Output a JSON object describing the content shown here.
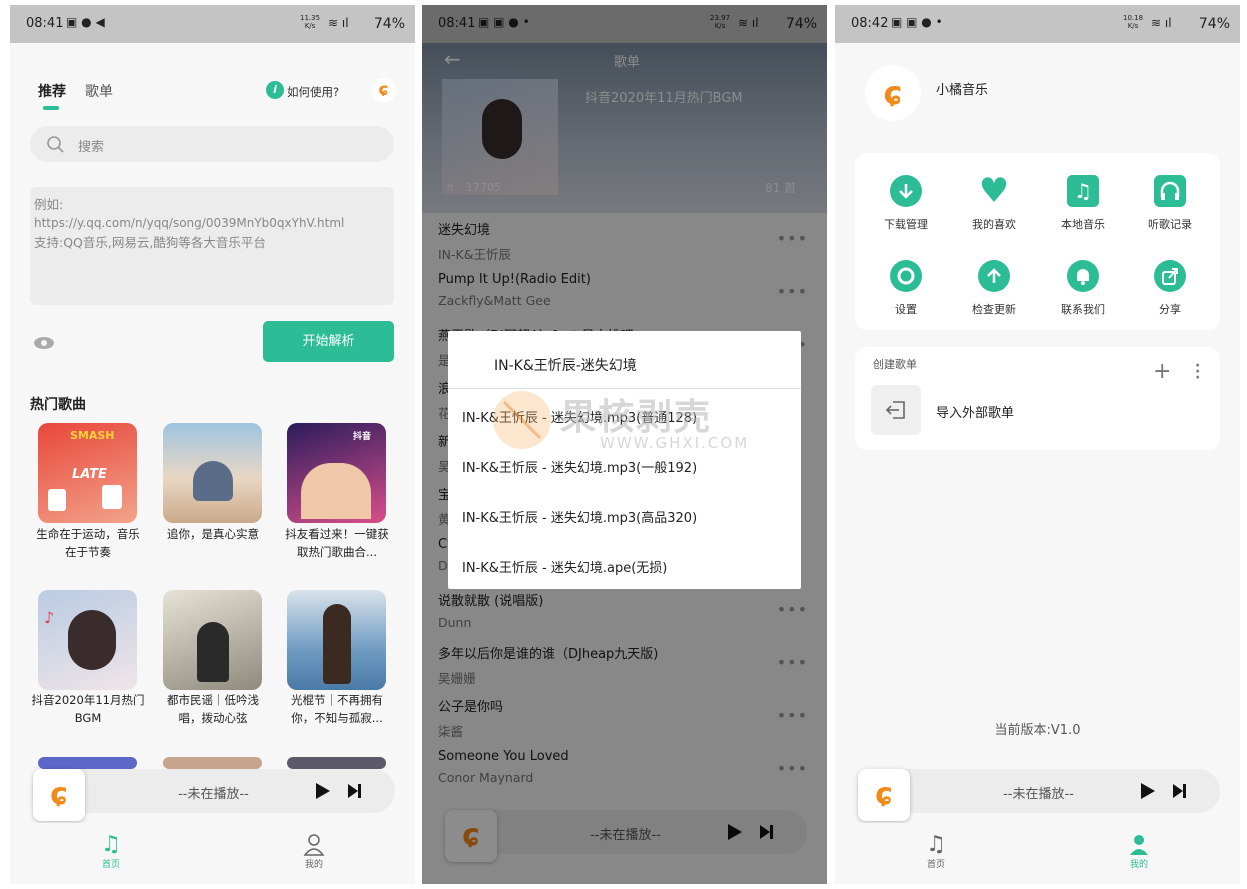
{
  "status_bars": [
    {
      "time": "08:41",
      "speed_top": "11.35",
      "speed_unit": "K/s",
      "battery": "74%"
    },
    {
      "time": "08:41",
      "speed_top": "23.97",
      "speed_unit": "K/s",
      "battery": "74%"
    },
    {
      "time": "08:42",
      "speed_top": "10.18",
      "speed_unit": "K/s",
      "battery": "74%"
    }
  ],
  "home": {
    "tabs": [
      "推荐",
      "歌单"
    ],
    "help_label": "如何使用?",
    "search_placeholder": "搜索",
    "input_hint_1": "例如:",
    "input_hint_2": "https://y.qq.com/n/yqq/song/0039MnYb0qxYhV.html",
    "input_hint_3": "支持:QQ音乐,网易云,酷狗等各大音乐平台",
    "parse_button": "开始解析",
    "section_title": "热门歌曲",
    "playlists": [
      {
        "cap1": "生命在于运动，音乐",
        "cap2": "在于节奏",
        "cover_word1": "SMASH",
        "cover_word2": "LATE",
        "c1": "#e8473b",
        "c2": "#f2a38a"
      },
      {
        "cap1": "追你，是真心实意",
        "cap2": "",
        "c1": "#9fc4e0",
        "c2": "#e9d7c4"
      },
      {
        "cap1": "抖友看过来！一键获",
        "cap2": "取热门歌曲合...",
        "cover_word1": "抖音",
        "c1": "#2b1c5c",
        "c2": "#d94f8a"
      },
      {
        "cap1": "抖音2020年11月热门",
        "cap2": "BGM",
        "c1": "#b9cbe3",
        "c2": "#f0e5e8"
      },
      {
        "cap1": "都市民谣｜低吟浅",
        "cap2": "唱，拨动心弦",
        "c1": "#e7e2d6",
        "c2": "#8e8a7c"
      },
      {
        "cap1": "光棍节｜不再拥有",
        "cap2": "你，不知与孤寂...",
        "c1": "#6f9bc2",
        "c2": "#d9e2ea"
      }
    ]
  },
  "player": {
    "status": "--未在播放--"
  },
  "nav": {
    "home": "首页",
    "mine": "我的"
  },
  "playlist_page": {
    "title": "歌单",
    "playlist_name": "抖音2020年11月热门BGM",
    "play_count": "17705",
    "song_count": "81 首",
    "songs": [
      {
        "title": "迷失幻境",
        "artist": "IN-K&王忻辰"
      },
      {
        "title": "Pump It Up!(Radio Edit)",
        "artist": "Zackfly&Matt Gee"
      },
      {
        "title": "燕无歇（DJ阿超A）feat 吴大桃吧",
        "artist": "是"
      },
      {
        "title": "浪",
        "artist": "花"
      },
      {
        "title": "新",
        "artist": "吴"
      },
      {
        "title": "宝",
        "artist": "黄"
      },
      {
        "title": "Cy",
        "artist": "D"
      },
      {
        "title": "说散就散 (说唱版)",
        "artist": "Dunn"
      },
      {
        "title": "多年以后你是谁的谁（DJheap九天版)",
        "artist": "吴姗姗"
      },
      {
        "title": "公子是你吗",
        "artist": "柒酱"
      },
      {
        "title": "Someone You Loved",
        "artist": "Conor Maynard"
      }
    ],
    "dialog": {
      "title": "IN-K&王忻辰-迷失幻境",
      "options": [
        "IN-K&王忻辰 - 迷失幻境.mp3(普通128)",
        "IN-K&王忻辰 - 迷失幻境.mp3(一般192)",
        "IN-K&王忻辰 - 迷失幻境.mp3(高品320)",
        "IN-K&王忻辰 - 迷失幻境.ape(无损)"
      ]
    },
    "watermark_text": "果核剥壳",
    "watermark_url": "WWW.GHXI.COM"
  },
  "mine": {
    "app_name": "小橘音乐",
    "grid": [
      {
        "label": "下载管理",
        "icon": "download-icon"
      },
      {
        "label": "我的喜欢",
        "icon": "heart-icon"
      },
      {
        "label": "本地音乐",
        "icon": "music-note-icon"
      },
      {
        "label": "听歌记录",
        "icon": "headphones-icon"
      },
      {
        "label": "设置",
        "icon": "gear-icon"
      },
      {
        "label": "检查更新",
        "icon": "arrow-up-icon"
      },
      {
        "label": "联系我们",
        "icon": "bell-icon"
      },
      {
        "label": "分享",
        "icon": "share-icon"
      }
    ],
    "create_title": "创建歌单",
    "import_label": "导入外部歌单",
    "version": "当前版本:V1.0"
  },
  "accent": "#2dbd96",
  "logo_color": "#f28a1a"
}
